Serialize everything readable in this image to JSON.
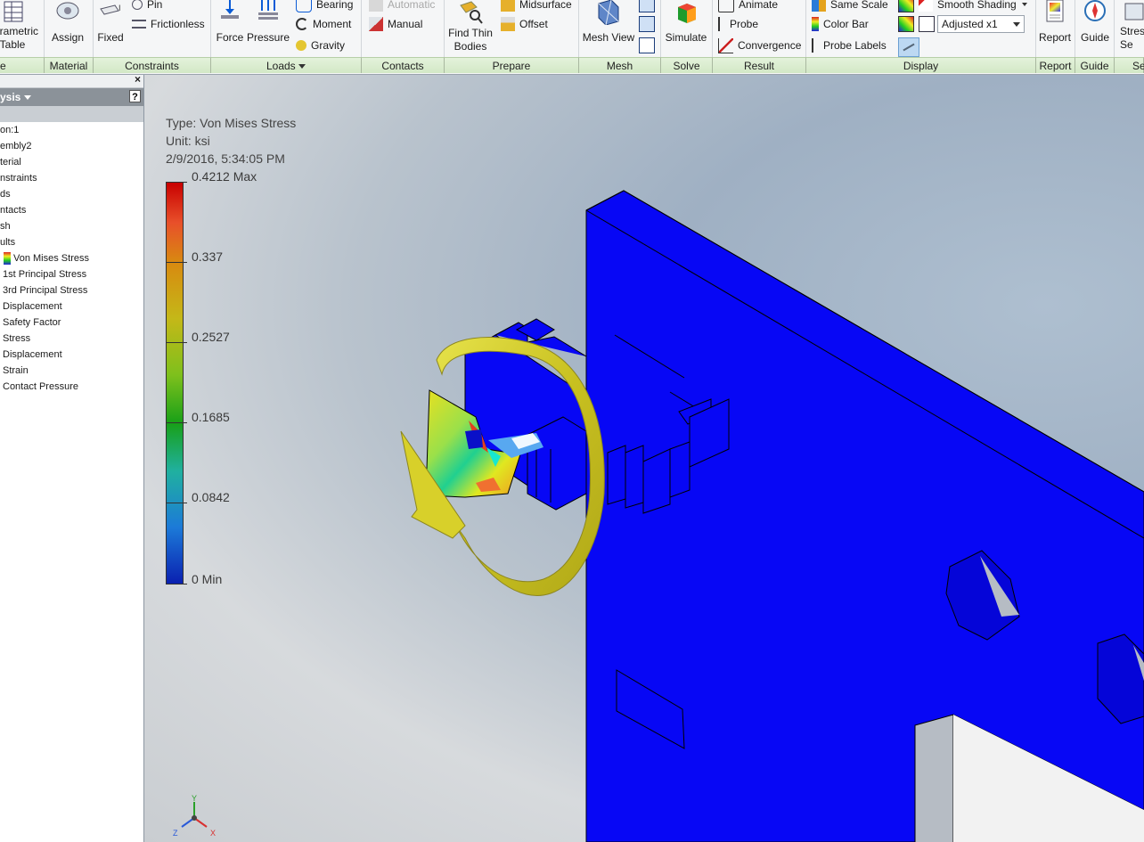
{
  "ribbon": {
    "buttons": {
      "parametric_table": "Parametric\nTable",
      "assign": "Assign",
      "fixed": "Fixed",
      "pin": "Pin",
      "frictionless": "Frictionless",
      "force": "Force",
      "pressure": "Pressure",
      "bearing": "Bearing",
      "moment": "Moment",
      "gravity": "Gravity",
      "automatic": "Automatic",
      "manual": "Manual",
      "find_thin_bodies": "Find Thin\nBodies",
      "midsurface": "Midsurface",
      "offset": "Offset",
      "mesh_view": "Mesh View",
      "simulate": "Simulate",
      "animate": "Animate",
      "probe": "Probe",
      "convergence": "Convergence",
      "same_scale": "Same Scale",
      "color_bar": "Color Bar",
      "probe_labels": "Probe Labels",
      "smooth_shading": "Smooth Shading",
      "adjusted_select": "Adjusted x1",
      "report": "Report",
      "guide": "Guide",
      "stress_settings": "Stress\nSe"
    },
    "groups": {
      "manage": "e",
      "material": "Material",
      "constraints": "Constraints",
      "loads": "Loads",
      "contacts": "Contacts",
      "prepare": "Prepare",
      "mesh": "Mesh",
      "solve": "Solve",
      "result": "Result",
      "display": "Display",
      "report": "Report",
      "guide": "Guide",
      "settings": "Se"
    }
  },
  "browser": {
    "header": "ysis",
    "items": [
      "on:1",
      "embly2",
      "terial",
      "nstraints",
      "ds",
      "ntacts",
      "sh",
      "ults",
      "Von Mises Stress",
      "1st Principal Stress",
      "3rd Principal Stress",
      "Displacement",
      "Safety Factor",
      "Stress",
      "Displacement",
      "Strain",
      "Contact Pressure"
    ]
  },
  "viewport": {
    "type_line": "Type: Von Mises Stress",
    "unit_line": "Unit: ksi",
    "timestamp": "2/9/2016, 5:34:05 PM",
    "scale_labels": [
      "0.4212 Max",
      "0.337",
      "0.2527",
      "0.1685",
      "0.0842",
      "0 Min"
    ],
    "triad_axes": [
      "Y",
      "Z",
      "X"
    ]
  },
  "colors": {
    "part_fill": "#0707f5",
    "moment_arrow": "#d7d22a",
    "ribbon_group_bar": "#d3e8c6"
  }
}
